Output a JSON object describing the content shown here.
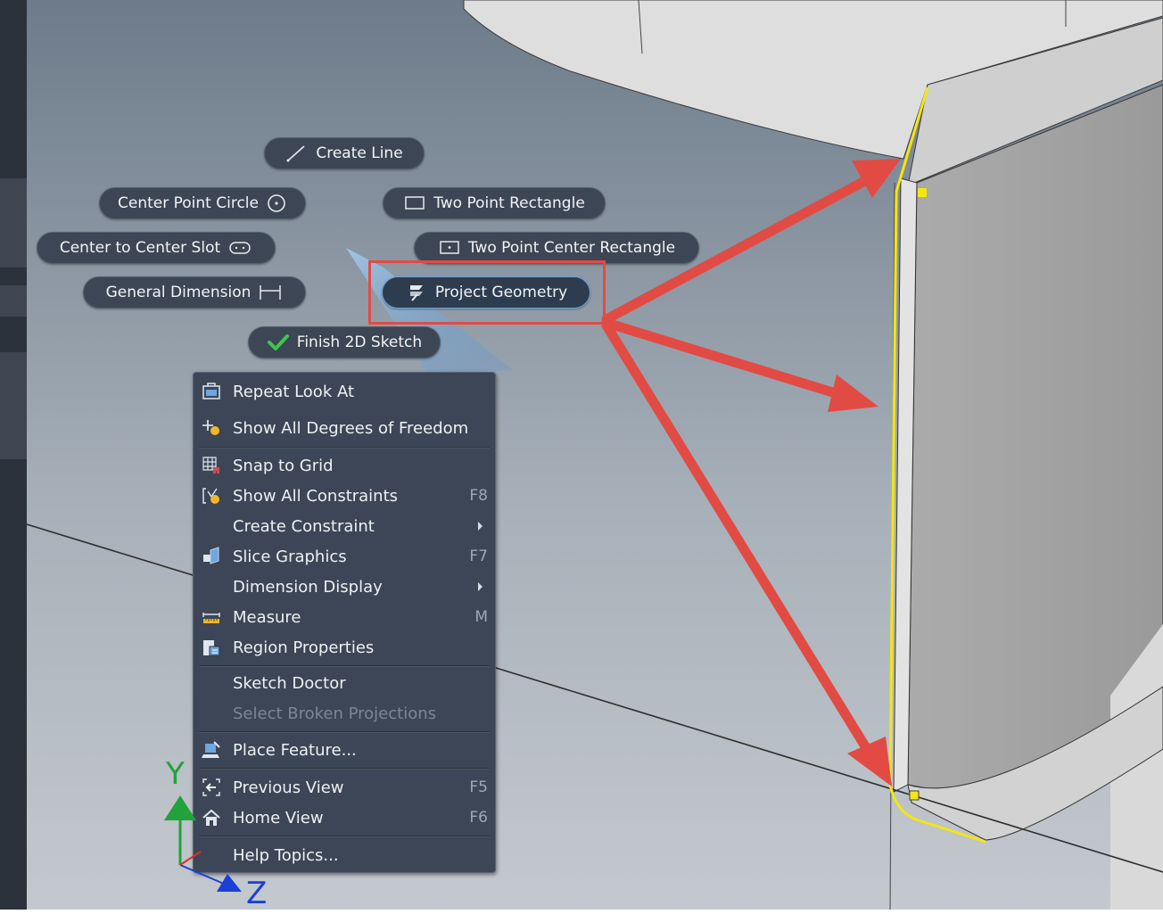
{
  "marking_menu": {
    "create_line": "Create Line",
    "center_point_circle": "Center Point Circle",
    "two_point_rectangle": "Two Point Rectangle",
    "center_to_center_slot": "Center to Center Slot",
    "two_point_center_rectangle": "Two Point Center Rectangle",
    "general_dimension": "General Dimension",
    "project_geometry": "Project Geometry",
    "finish_2d_sketch": "Finish 2D Sketch"
  },
  "context_menu": {
    "items": [
      {
        "label": "Repeat Look At",
        "shortcut": "",
        "icon": "look-at-icon"
      },
      {
        "label": "Show All Degrees of Freedom",
        "shortcut": "",
        "icon": "degrees-of-freedom-icon"
      },
      {
        "label": "Snap to Grid",
        "shortcut": "",
        "icon": "snap-grid-icon"
      },
      {
        "label": "Show All Constraints",
        "shortcut": "F8",
        "icon": "constraints-icon"
      },
      {
        "label": "Create Constraint",
        "shortcut": "",
        "icon": ""
      },
      {
        "label": "Slice Graphics",
        "shortcut": "F7",
        "icon": "slice-graphics-icon"
      },
      {
        "label": "Dimension Display",
        "shortcut": "",
        "icon": ""
      },
      {
        "label": "Measure",
        "shortcut": "M",
        "icon": "measure-icon"
      },
      {
        "label": "Region Properties",
        "shortcut": "",
        "icon": "region-properties-icon"
      },
      {
        "label": "Sketch Doctor",
        "shortcut": "",
        "icon": ""
      },
      {
        "label": "Select Broken Projections",
        "shortcut": "",
        "icon": "",
        "disabled": true
      },
      {
        "label": "Place Feature...",
        "shortcut": "",
        "icon": "place-feature-icon"
      },
      {
        "label": "Previous View",
        "shortcut": "F5",
        "icon": "previous-view-icon"
      },
      {
        "label": "Home View",
        "shortcut": "F6",
        "icon": "home-icon"
      },
      {
        "label": "Help Topics...",
        "shortcut": "",
        "icon": ""
      }
    ]
  },
  "axes": {
    "y_label": "Y",
    "z_label": "Z"
  },
  "colors": {
    "annotation_red": "#e24b44",
    "sketch_yellow": "#f5e60f",
    "axis_green": "#1fa33a",
    "axis_blue": "#1d3fd6",
    "menu_bg": "#3c4656"
  }
}
